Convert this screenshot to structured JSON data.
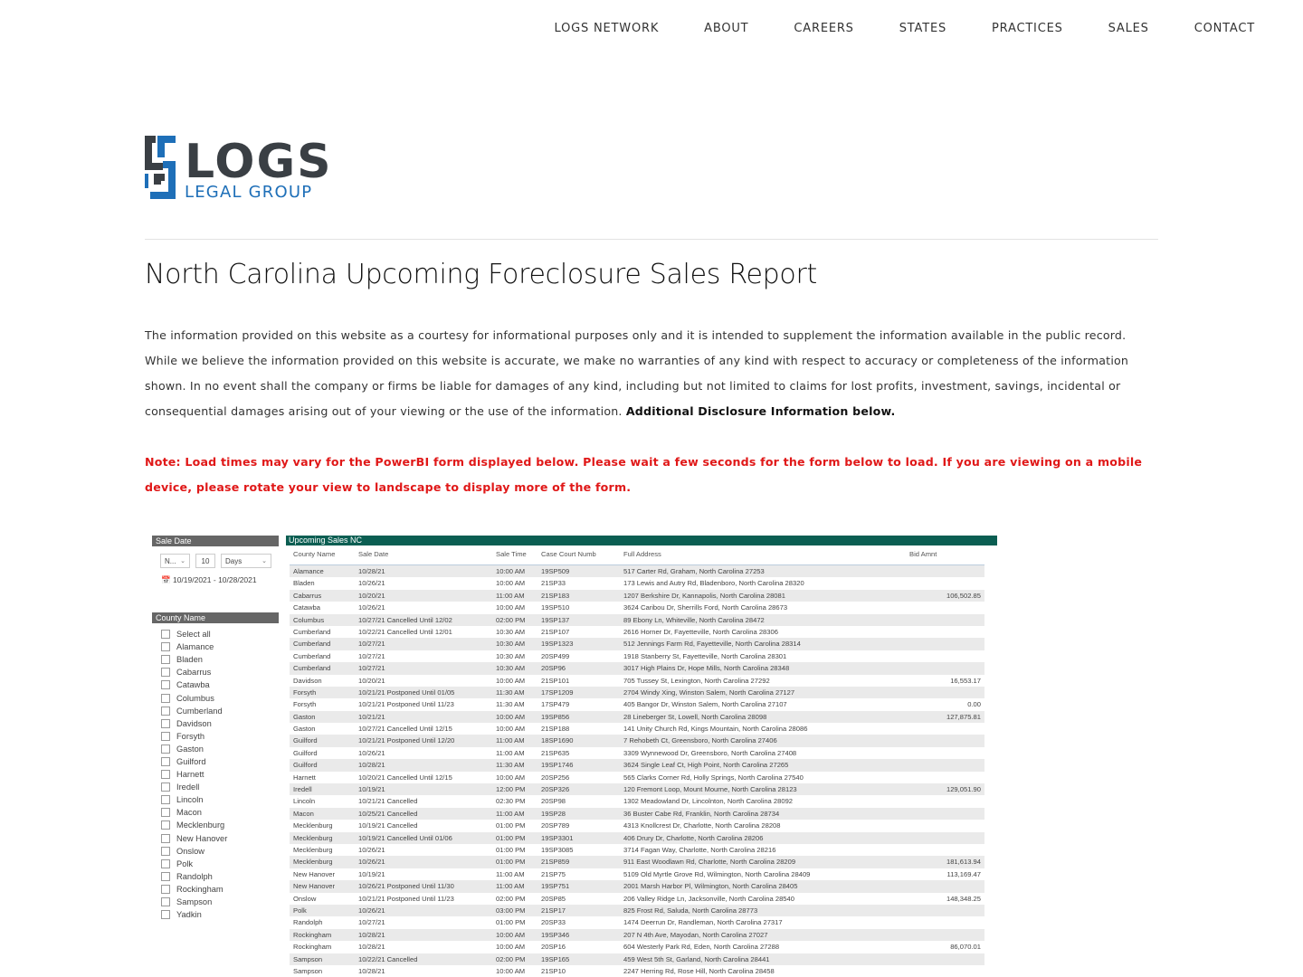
{
  "nav": [
    "LOGS NETWORK",
    "ABOUT",
    "CAREERS",
    "STATES",
    "PRACTICES",
    "SALES",
    "CONTACT"
  ],
  "logo": {
    "line1": "LOGS",
    "line2": "LEGAL GROUP",
    "colors": {
      "dark": "#3a3f44",
      "blue": "#1e6fb8"
    }
  },
  "page": {
    "title": "North Carolina Upcoming Foreclosure Sales Report",
    "disclaimer": "The information provided on this website as a courtesy for informational purposes only and it is intended to supplement the information available in the public record. While we believe the information provided on this website is accurate, we make no warranties of any kind with respect to accuracy or completeness of the information shown. In no event shall the company or firms be liable for damages of any kind, including but not limited to claims for lost profits, investment, savings, incidental or consequential damages arising out of your viewing or the use of the information.",
    "disclaimer_bold": "Additional Disclosure Information below.",
    "note": "Note: Load times may vary for the PowerBI form displayed below. Please wait a few seconds for the form below to load. If you are viewing on a mobile device, please rotate your view to landscape to display more of the form.",
    "note_color": "#e01818"
  },
  "report": {
    "sale_date_slicer": {
      "title": "Sale Date",
      "mode": "N...",
      "count": "10",
      "unit": "Days",
      "range": "10/19/2021 - 10/28/2021"
    },
    "county_slicer": {
      "title": "County Name",
      "items": [
        "Select all",
        "Alamance",
        "Bladen",
        "Cabarrus",
        "Catawba",
        "Columbus",
        "Cumberland",
        "Davidson",
        "Forsyth",
        "Gaston",
        "Guilford",
        "Harnett",
        "Iredell",
        "Lincoln",
        "Macon",
        "Mecklenburg",
        "New Hanover",
        "Onslow",
        "Polk",
        "Randolph",
        "Rockingham",
        "Sampson",
        "Yadkin"
      ]
    },
    "table": {
      "title": "Upcoming Sales NC",
      "header_color": "#0b5e52",
      "columns": [
        "County Name",
        "Sale Date",
        "Sale Time",
        "Case Court Numb",
        "Full Address",
        "Bid Amnt"
      ],
      "rows": [
        [
          "Alamance",
          "10/28/21",
          "10:00 AM",
          "19SP509",
          "517 Carter Rd, Graham, North Carolina 27253",
          ""
        ],
        [
          "Bladen",
          "10/26/21",
          "10:00 AM",
          "21SP33",
          "173 Lewis and Autry Rd, Bladenboro, North Carolina 28320",
          ""
        ],
        [
          "Cabarrus",
          "10/20/21",
          "11:00 AM",
          "21SP183",
          "1207 Berkshire Dr, Kannapolis, North Carolina 28081",
          "106,502.85"
        ],
        [
          "Catawba",
          "10/26/21",
          "10:00 AM",
          "19SP510",
          "3624 Caribou Dr, Sherrills Ford, North Carolina 28673",
          ""
        ],
        [
          "Columbus",
          "10/27/21 Cancelled Until 12/02",
          "02:00 PM",
          "19SP137",
          "89 Ebony Ln, Whiteville, North Carolina 28472",
          ""
        ],
        [
          "Cumberland",
          "10/22/21 Cancelled Until 12/01",
          "10:30 AM",
          "21SP107",
          "2616 Horner Dr, Fayetteville, North Carolina 28306",
          ""
        ],
        [
          "Cumberland",
          "10/27/21",
          "10:30 AM",
          "19SP1323",
          "512 Jennings Farm Rd, Fayetteville, North Carolina 28314",
          ""
        ],
        [
          "Cumberland",
          "10/27/21",
          "10:30 AM",
          "20SP499",
          "1918 Stanberry St, Fayetteville, North Carolina 28301",
          ""
        ],
        [
          "Cumberland",
          "10/27/21",
          "10:30 AM",
          "20SP96",
          "3017 High Plains Dr, Hope Mills, North Carolina 28348",
          ""
        ],
        [
          "Davidson",
          "10/20/21",
          "10:00 AM",
          "21SP101",
          "705 Tussey St, Lexington, North Carolina 27292",
          "16,553.17"
        ],
        [
          "Forsyth",
          "10/21/21 Postponed Until 01/05",
          "11:30 AM",
          "17SP1209",
          "2704 Windy Xing, Winston Salem, North Carolina 27127",
          ""
        ],
        [
          "Forsyth",
          "10/21/21 Postponed Until 11/23",
          "11:30 AM",
          "17SP479",
          "405 Bangor Dr, Winston Salem, North Carolina 27107",
          "0.00"
        ],
        [
          "Gaston",
          "10/21/21",
          "10:00 AM",
          "19SP856",
          "28 Lineberger St, Lowell, North Carolina 28098",
          "127,875.81"
        ],
        [
          "Gaston",
          "10/27/21 Cancelled Until 12/15",
          "10:00 AM",
          "21SP188",
          "141 Unity Church Rd, Kings Mountain, North Carolina 28086",
          ""
        ],
        [
          "Guilford",
          "10/21/21 Postponed Until 12/20",
          "11:00 AM",
          "18SP1690",
          "7 Rehobeth Ct, Greensboro, North Carolina 27406",
          ""
        ],
        [
          "Guilford",
          "10/26/21",
          "11:00 AM",
          "21SP635",
          "3309 Wynnewood Dr, Greensboro, North Carolina 27408",
          ""
        ],
        [
          "Guilford",
          "10/28/21",
          "11:30 AM",
          "19SP1746",
          "3624 Single Leaf Ct, High Point, North Carolina 27265",
          ""
        ],
        [
          "Harnett",
          "10/20/21 Cancelled Until 12/15",
          "10:00 AM",
          "20SP256",
          "565 Clarks Corner Rd, Holly Springs, North Carolina 27540",
          ""
        ],
        [
          "Iredell",
          "10/19/21",
          "12:00 PM",
          "20SP326",
          "120 Fremont Loop, Mount Mourne, North Carolina 28123",
          "129,051.90"
        ],
        [
          "Lincoln",
          "10/21/21 Cancelled",
          "02:30 PM",
          "20SP98",
          "1302 Meadowland Dr, Lincolnton, North Carolina 28092",
          ""
        ],
        [
          "Macon",
          "10/25/21 Cancelled",
          "11:00 AM",
          "19SP28",
          "36 Buster Cabe Rd, Franklin, North Carolina 28734",
          ""
        ],
        [
          "Mecklenburg",
          "10/19/21 Cancelled",
          "01:00 PM",
          "20SP789",
          "4313 Knollcrest Dr, Charlotte, North Carolina 28208",
          ""
        ],
        [
          "Mecklenburg",
          "10/19/21 Cancelled Until 01/06",
          "01:00 PM",
          "19SP3301",
          "406 Drury Dr, Charlotte, North Carolina 28206",
          ""
        ],
        [
          "Mecklenburg",
          "10/26/21",
          "01:00 PM",
          "19SP3085",
          "3714 Fagan Way, Charlotte, North Carolina 28216",
          ""
        ],
        [
          "Mecklenburg",
          "10/26/21",
          "01:00 PM",
          "21SP859",
          "911 East Woodlawn Rd, Charlotte, North Carolina 28209",
          "181,613.94"
        ],
        [
          "New Hanover",
          "10/19/21",
          "11:00 AM",
          "21SP75",
          "5109 Old Myrtle Grove Rd, Wilmington, North Carolina 28409",
          "113,169.47"
        ],
        [
          "New Hanover",
          "10/26/21 Postponed Until 11/30",
          "11:00 AM",
          "19SP751",
          "2001 Marsh Harbor Pl, Wilmington, North Carolina 28405",
          ""
        ],
        [
          "Onslow",
          "10/21/21 Postponed Until 11/23",
          "02:00 PM",
          "20SP85",
          "206 Valley Ridge Ln, Jacksonville, North Carolina 28540",
          "148,348.25"
        ],
        [
          "Polk",
          "10/26/21",
          "03:00 PM",
          "21SP17",
          "825 Frost Rd, Saluda, North Carolina 28773",
          ""
        ],
        [
          "Randolph",
          "10/27/21",
          "01:00 PM",
          "20SP33",
          "1474 Deerrun Dr, Randleman, North Carolina 27317",
          ""
        ],
        [
          "Rockingham",
          "10/28/21",
          "10:00 AM",
          "19SP346",
          "207 N 4th Ave, Mayodan, North Carolina 27027",
          ""
        ],
        [
          "Rockingham",
          "10/28/21",
          "10:00 AM",
          "20SP16",
          "604 Westerly Park Rd, Eden, North Carolina 27288",
          "86,070.01"
        ],
        [
          "Sampson",
          "10/22/21 Cancelled",
          "02:00 PM",
          "19SP165",
          "459 West 5th St, Garland, North Carolina 28441",
          ""
        ],
        [
          "Sampson",
          "10/28/21",
          "10:00 AM",
          "21SP10",
          "2247 Herring Rd, Rose Hill, North Carolina 28458",
          ""
        ]
      ]
    }
  }
}
